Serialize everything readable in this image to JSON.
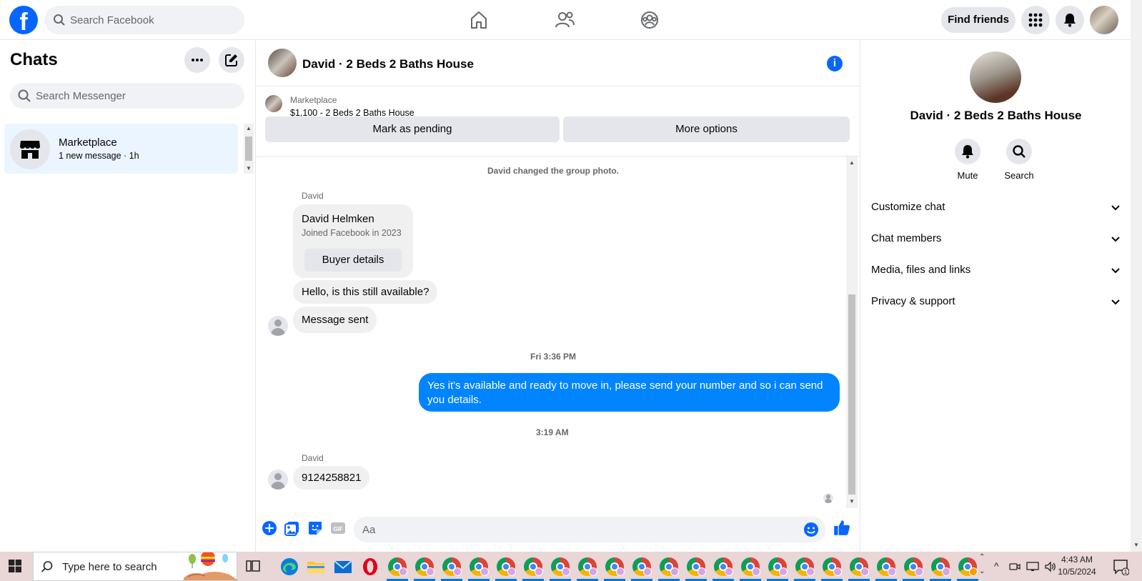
{
  "topnav": {
    "logo": "f",
    "search_placeholder": "Search Facebook",
    "find_friends": "Find friends"
  },
  "chats": {
    "title": "Chats",
    "search_placeholder": "Search Messenger",
    "items": [
      {
        "name": "Marketplace",
        "preview": "1 new message",
        "time": "· 1h"
      }
    ]
  },
  "conversation": {
    "title": "David · 2 Beds 2 Baths House",
    "info_glyph": "i",
    "listing": {
      "label": "Marketplace",
      "price_title": "$1,100 - 2 Beds 2 Baths House"
    },
    "mark_pending": "Mark as pending",
    "more_options": "More options",
    "system_message": "David changed the group photo.",
    "sender1": "David",
    "card": {
      "name": "David Helmken",
      "joined": "Joined Facebook in 2023",
      "button": "Buyer details"
    },
    "msg1": "Hello, is this still available?",
    "msg2": "Message sent",
    "time1": "Fri 3:36 PM",
    "out1_line1": "Yes it's available and ready to move in, please send your number and so i can send",
    "out1_line2": "you details.",
    "time2": "3:19 AM",
    "sender2": "David",
    "msg3": "9124258821",
    "composer_placeholder": "Aa"
  },
  "right_panel": {
    "name": "David · 2 Beds 2 Baths House",
    "mute": "Mute",
    "search": "Search",
    "sections": [
      "Customize chat",
      "Chat members",
      "Media, files and links",
      "Privacy & support"
    ]
  },
  "taskbar": {
    "search_placeholder": "Type here to search",
    "time": "4:43 AM",
    "date": "10/5/2024",
    "notif_count": "1"
  }
}
